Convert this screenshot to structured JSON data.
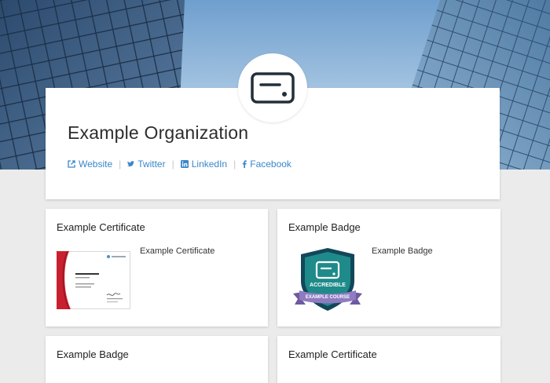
{
  "organization": {
    "name": "Example Organization",
    "links": [
      {
        "label": "Website",
        "icon": "external-link-icon"
      },
      {
        "label": "Twitter",
        "icon": "twitter-icon"
      },
      {
        "label": "LinkedIn",
        "icon": "linkedin-icon"
      },
      {
        "label": "Facebook",
        "icon": "facebook-icon"
      }
    ],
    "logo_icon": "credential-card-icon"
  },
  "credentials": [
    {
      "title": "Example Certificate",
      "description": "Example Certificate",
      "kind": "certificate"
    },
    {
      "title": "Example Badge",
      "description": "Example Badge",
      "kind": "badge"
    },
    {
      "title": "Example Badge",
      "kind": "badge"
    },
    {
      "title": "Example Certificate",
      "kind": "certificate"
    }
  ],
  "certificate_thumb": {
    "brand": "YourLogoHere",
    "heading": "Example Certificate",
    "accent_color": "#c8202f"
  },
  "badge_thumb": {
    "ribbon_text": "ACCREDIBLE",
    "banner_text": "EXAMPLE COURSE",
    "shield_color": "#1f8a8a",
    "banner_color": "#8f7bc0"
  },
  "colors": {
    "link": "#3a87c8",
    "background": "#ebebeb"
  }
}
